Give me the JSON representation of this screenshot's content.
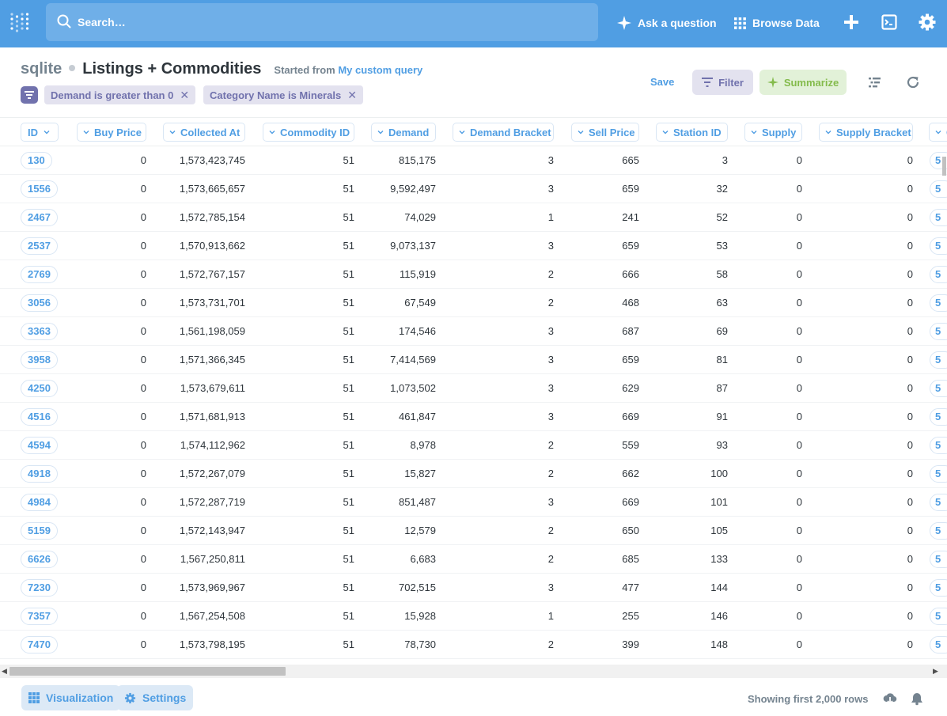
{
  "nav": {
    "search_placeholder": "Search…",
    "ask_label": "Ask a question",
    "browse_label": "Browse Data"
  },
  "header": {
    "db_name": "sqlite",
    "question_name": "Listings + Commodities",
    "started_prefix": "Started from",
    "started_link": "My custom query",
    "save_label": "Save",
    "filter_label": "Filter",
    "summarize_label": "Summarize"
  },
  "filters": [
    {
      "label": "Demand is greater than 0"
    },
    {
      "label": "Category Name is Minerals"
    }
  ],
  "table": {
    "columns": [
      "ID",
      "Buy Price",
      "Collected At",
      "Commodity ID",
      "Demand",
      "Demand Bracket",
      "Sell Price",
      "Station ID",
      "Supply",
      "Supply Bracket",
      "Co"
    ],
    "rows": [
      {
        "id": "130",
        "buy": "0",
        "collected": "1,573,423,745",
        "commodity": "51",
        "demand": "815,175",
        "bracket": "3",
        "sell": "665",
        "station": "3",
        "supply": "0",
        "sbracket": "0",
        "trunc": "5"
      },
      {
        "id": "1556",
        "buy": "0",
        "collected": "1,573,665,657",
        "commodity": "51",
        "demand": "9,592,497",
        "bracket": "3",
        "sell": "659",
        "station": "32",
        "supply": "0",
        "sbracket": "0",
        "trunc": "5"
      },
      {
        "id": "2467",
        "buy": "0",
        "collected": "1,572,785,154",
        "commodity": "51",
        "demand": "74,029",
        "bracket": "1",
        "sell": "241",
        "station": "52",
        "supply": "0",
        "sbracket": "0",
        "trunc": "5"
      },
      {
        "id": "2537",
        "buy": "0",
        "collected": "1,570,913,662",
        "commodity": "51",
        "demand": "9,073,137",
        "bracket": "3",
        "sell": "659",
        "station": "53",
        "supply": "0",
        "sbracket": "0",
        "trunc": "5"
      },
      {
        "id": "2769",
        "buy": "0",
        "collected": "1,572,767,157",
        "commodity": "51",
        "demand": "115,919",
        "bracket": "2",
        "sell": "666",
        "station": "58",
        "supply": "0",
        "sbracket": "0",
        "trunc": "5"
      },
      {
        "id": "3056",
        "buy": "0",
        "collected": "1,573,731,701",
        "commodity": "51",
        "demand": "67,549",
        "bracket": "2",
        "sell": "468",
        "station": "63",
        "supply": "0",
        "sbracket": "0",
        "trunc": "5"
      },
      {
        "id": "3363",
        "buy": "0",
        "collected": "1,561,198,059",
        "commodity": "51",
        "demand": "174,546",
        "bracket": "3",
        "sell": "687",
        "station": "69",
        "supply": "0",
        "sbracket": "0",
        "trunc": "5"
      },
      {
        "id": "3958",
        "buy": "0",
        "collected": "1,571,366,345",
        "commodity": "51",
        "demand": "7,414,569",
        "bracket": "3",
        "sell": "659",
        "station": "81",
        "supply": "0",
        "sbracket": "0",
        "trunc": "5"
      },
      {
        "id": "4250",
        "buy": "0",
        "collected": "1,573,679,611",
        "commodity": "51",
        "demand": "1,073,502",
        "bracket": "3",
        "sell": "629",
        "station": "87",
        "supply": "0",
        "sbracket": "0",
        "trunc": "5"
      },
      {
        "id": "4516",
        "buy": "0",
        "collected": "1,571,681,913",
        "commodity": "51",
        "demand": "461,847",
        "bracket": "3",
        "sell": "669",
        "station": "91",
        "supply": "0",
        "sbracket": "0",
        "trunc": "5"
      },
      {
        "id": "4594",
        "buy": "0",
        "collected": "1,574,112,962",
        "commodity": "51",
        "demand": "8,978",
        "bracket": "2",
        "sell": "559",
        "station": "93",
        "supply": "0",
        "sbracket": "0",
        "trunc": "5"
      },
      {
        "id": "4918",
        "buy": "0",
        "collected": "1,572,267,079",
        "commodity": "51",
        "demand": "15,827",
        "bracket": "2",
        "sell": "662",
        "station": "100",
        "supply": "0",
        "sbracket": "0",
        "trunc": "5"
      },
      {
        "id": "4984",
        "buy": "0",
        "collected": "1,572,287,719",
        "commodity": "51",
        "demand": "851,487",
        "bracket": "3",
        "sell": "669",
        "station": "101",
        "supply": "0",
        "sbracket": "0",
        "trunc": "5"
      },
      {
        "id": "5159",
        "buy": "0",
        "collected": "1,572,143,947",
        "commodity": "51",
        "demand": "12,579",
        "bracket": "2",
        "sell": "650",
        "station": "105",
        "supply": "0",
        "sbracket": "0",
        "trunc": "5"
      },
      {
        "id": "6626",
        "buy": "0",
        "collected": "1,567,250,811",
        "commodity": "51",
        "demand": "6,683",
        "bracket": "2",
        "sell": "685",
        "station": "133",
        "supply": "0",
        "sbracket": "0",
        "trunc": "5"
      },
      {
        "id": "7230",
        "buy": "0",
        "collected": "1,573,969,967",
        "commodity": "51",
        "demand": "702,515",
        "bracket": "3",
        "sell": "477",
        "station": "144",
        "supply": "0",
        "sbracket": "0",
        "trunc": "5"
      },
      {
        "id": "7357",
        "buy": "0",
        "collected": "1,567,254,508",
        "commodity": "51",
        "demand": "15,928",
        "bracket": "1",
        "sell": "255",
        "station": "146",
        "supply": "0",
        "sbracket": "0",
        "trunc": "5"
      },
      {
        "id": "7470",
        "buy": "0",
        "collected": "1,573,798,195",
        "commodity": "51",
        "demand": "78,730",
        "bracket": "2",
        "sell": "399",
        "station": "148",
        "supply": "0",
        "sbracket": "0",
        "trunc": "5"
      }
    ]
  },
  "footer": {
    "visualization_label": "Visualization",
    "settings_label": "Settings",
    "rows_info": "Showing first 2,000 rows"
  },
  "colors": {
    "brand": "#509ee3",
    "filter": "#7172ad",
    "summarize": "#84bb4c"
  }
}
